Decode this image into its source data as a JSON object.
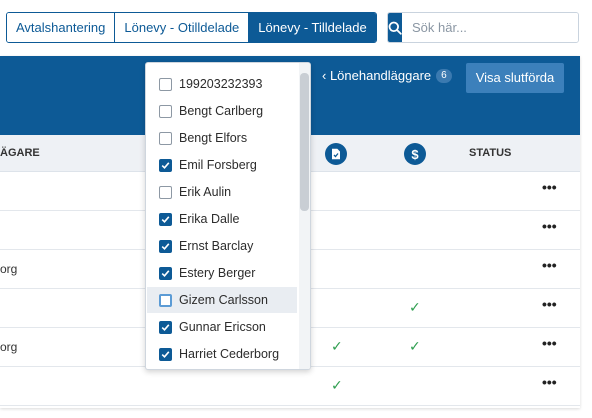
{
  "tabs": [
    {
      "label": "Avtalshantering"
    },
    {
      "label": "Lönevy - Otilldelade"
    },
    {
      "label": "Lönevy - Tilldelade"
    }
  ],
  "search": {
    "placeholder": "Sök här..."
  },
  "header": {
    "handlaggare_label": "‹ Lönehandläggare",
    "handlaggare_count": "6",
    "show_completed_label": "Visa slutförda"
  },
  "columns": {
    "name_partial": "ÄGARE",
    "status": "STATUS",
    "dollar_icon": "$"
  },
  "rows": [
    {
      "name": "",
      "check1": "",
      "check2": "",
      "actions": "•••"
    },
    {
      "name": "",
      "check1": "",
      "check2": "",
      "actions": "•••"
    },
    {
      "name": "org",
      "check1": "",
      "check2": "",
      "actions": "•••"
    },
    {
      "name": "",
      "check1": "",
      "check2": "✓",
      "actions": "•••"
    },
    {
      "name": "org",
      "check1": "✓",
      "check2": "✓",
      "actions": "•••"
    },
    {
      "name": "",
      "check1": "✓",
      "check2": "",
      "actions": "•••"
    }
  ],
  "dropdown": {
    "items": [
      {
        "label": "199203232393",
        "checked": false
      },
      {
        "label": "Bengt Carlberg",
        "checked": false
      },
      {
        "label": "Bengt Elfors",
        "checked": false
      },
      {
        "label": "Emil Forsberg",
        "checked": true
      },
      {
        "label": "Erik Aulin",
        "checked": false
      },
      {
        "label": "Erika Dalle",
        "checked": true
      },
      {
        "label": "Ernst Barclay",
        "checked": true
      },
      {
        "label": "Estery Berger",
        "checked": true
      },
      {
        "label": "Gizem Carlsson",
        "checked": false
      },
      {
        "label": "Gunnar Ericson",
        "checked": true
      },
      {
        "label": "Harriet Cederborg",
        "checked": true
      }
    ]
  },
  "colors": {
    "primary": "#0d5a96",
    "check_green": "#2e9e4f"
  }
}
